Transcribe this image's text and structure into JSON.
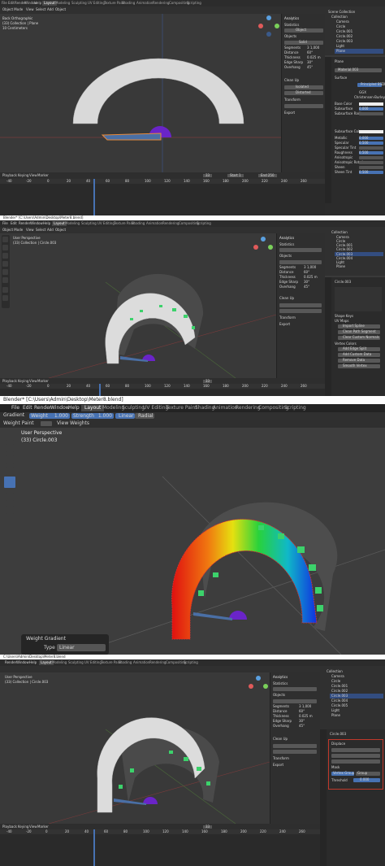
{
  "panel1": {
    "header": {
      "menus": [
        "View",
        "Select",
        "Add",
        "Object"
      ],
      "mode": "Object Mode",
      "tabs": [
        "Layout",
        "Modeling",
        "Sculpting",
        "UV Editing",
        "Texture Paint",
        "Shading",
        "Animation",
        "Rendering",
        "Compositing",
        "Scripting"
      ],
      "active_tab": "Layout"
    },
    "overlay": {
      "line1": "Back Orthographic",
      "line2": "(33) Collection | Plane",
      "line3": "10 Centimeters"
    },
    "npanel": {
      "analytics": "Analytics",
      "statistics": "Statistics",
      "mode": "Object",
      "objects": "Objects",
      "stats_title": "Solid",
      "rows": [
        {
          "label": "Segments",
          "value": "3 1,000"
        },
        {
          "label": "Distance",
          "value": "60°"
        },
        {
          "label": "Thickness",
          "value": "0.025 m"
        },
        {
          "label": "Edge Sharp",
          "value": "30°"
        },
        {
          "label": "Overhang",
          "value": "45°"
        }
      ],
      "sections": [
        "Clean Up",
        "Transform",
        "Export"
      ],
      "clean_up_buttons": [
        "Isolated",
        "Distorted"
      ],
      "transform": "Transform",
      "export": "Export"
    },
    "outliner": {
      "title": "Scene Collection",
      "items": [
        "Collection",
        "Camera",
        "Circle",
        "Circle.001",
        "Circle.002",
        "Circle.003",
        "Light",
        "Plane"
      ]
    },
    "properties": {
      "object": "Plane",
      "material": "Material.003",
      "surface": "Surface",
      "surface_value": "Principled BSDF",
      "rows": [
        "GGX",
        "Christensen-Burley",
        "Base Color",
        "Subsurface",
        "Subsurface Radius",
        "Subsurface Color",
        "Metallic",
        "Specular",
        "Specular Tint",
        "Roughness",
        "Anisotropic",
        "Anisotropic Rotation",
        "Sheen",
        "Sheen Tint"
      ],
      "values": [
        "0.000",
        "0.000",
        "0.500",
        "0.500",
        "0.000",
        "0.500",
        "0.000",
        "0.000",
        "0.500"
      ]
    },
    "timeline": {
      "menus": [
        "Playback",
        "Keying",
        "View",
        "Marker"
      ],
      "frame": "33",
      "start": "Start 1",
      "end": "End 250",
      "ticks": [
        "-40",
        "-20",
        "0",
        "20",
        "40",
        "60",
        "80",
        "100",
        "120",
        "140",
        "160",
        "180",
        "200",
        "220",
        "240",
        "260"
      ]
    }
  },
  "panel2": {
    "titlebar": "Blender* [C:\\Users\\Admin\\Desktop\\Meter8.blend]",
    "header": {
      "menus": [
        "File",
        "Edit",
        "Render",
        "Window",
        "Help"
      ],
      "tabs": [
        "Layout",
        "Modeling",
        "Sculpting",
        "UV Editing",
        "Texture Paint",
        "Shading",
        "Animation",
        "Rendering",
        "Compositing",
        "Scripting"
      ],
      "mode": "Object Mode",
      "sub_menus": [
        "View",
        "Select",
        "Add",
        "Object"
      ]
    },
    "overlay": {
      "line1": "User Perspective",
      "line2": "(33) Collection | Circle.003"
    },
    "npanel": {
      "analytics": "Analytics",
      "statistics": "Statistics",
      "objects": "Objects",
      "rows": [
        {
          "label": "Segments",
          "value": "3 1,000"
        },
        {
          "label": "Distance",
          "value": "60°"
        },
        {
          "label": "Thickness",
          "value": "0.025 m"
        },
        {
          "label": "Edge Sharp",
          "value": "30°"
        },
        {
          "label": "Overhang",
          "value": "45°"
        }
      ],
      "sections": [
        "Clean Up",
        "Transform",
        "Export"
      ]
    },
    "outliner": {
      "items": [
        "Collection",
        "Camera",
        "Circle",
        "Circle.001",
        "Circle.002",
        "Circle.003",
        "Circle.004",
        "Light",
        "Plane"
      ]
    },
    "properties": {
      "object": "Circle.003",
      "sections": [
        "Vertex Groups",
        "Shape Keys",
        "UV Maps",
        "Vertex Colors",
        "Face Maps",
        "Normals",
        "Texture Space",
        "Remesh",
        "Geometry Data",
        "Custom Properties"
      ],
      "buttons": [
        "Import Spline",
        "Clean Path Segment",
        "Clear Custom Normals",
        "Add Edge Split",
        "Add Custom Data",
        "Remove Data",
        "Smooth Vertex"
      ]
    },
    "timeline": {
      "menus": [
        "Playback",
        "Keying",
        "View",
        "Marker"
      ],
      "frame": "33",
      "ticks": [
        "-40",
        "-20",
        "0",
        "20",
        "40",
        "60",
        "80",
        "100",
        "120",
        "140",
        "160",
        "180",
        "200",
        "220",
        "240",
        "260"
      ]
    }
  },
  "panel3": {
    "titlebar": "Blender* [C:\\Users\\Admin\\Desktop\\Meter8.blend]",
    "menus": [
      "File",
      "Edit",
      "Render",
      "Window",
      "Help"
    ],
    "tabs": [
      "Layout",
      "Modeling",
      "Sculpting",
      "UV Editing",
      "Texture Paint",
      "Shading",
      "Animation",
      "Rendering",
      "Compositing",
      "Scripting"
    ],
    "active_tab": "Layout",
    "tool_header": {
      "tool": "Gradient",
      "weight_label": "Weight",
      "weight_value": "1.000",
      "strength_label": "Strength",
      "strength_value": "1.000",
      "linear": "Linear",
      "radial": "Radial"
    },
    "mode_header": {
      "mode": "Weight Paint",
      "view": "View",
      "weights": "Weights"
    },
    "overlay": {
      "line1": "User Perspective",
      "line2": "(33) Circle.003"
    },
    "redo": {
      "title": "Weight Gradient",
      "type_label": "Type",
      "type_value": "Linear"
    }
  },
  "panel4": {
    "titlebar": "C:\\Users\\Admin\\Desktop\\Meter8.blend",
    "header": {
      "menus": [
        "Render",
        "Window",
        "Help"
      ],
      "tabs": [
        "Layout",
        "Modeling",
        "Sculpting",
        "UV Editing",
        "Texture Paint",
        "Shading",
        "Animation",
        "Rendering",
        "Compositing",
        "Scripting"
      ]
    },
    "overlay": {
      "line1": "User Perspective",
      "line2": "(33) Collection | Circle.003"
    },
    "npanel": {
      "analytics": "Analytics",
      "statistics": "Statistics",
      "objects": "Objects",
      "rows": [
        {
          "label": "Segments",
          "value": "3 1,000"
        },
        {
          "label": "Distance",
          "value": "60°"
        },
        {
          "label": "Thickness",
          "value": "0.025 m"
        },
        {
          "label": "Edge Sharp",
          "value": "30°"
        },
        {
          "label": "Overhang",
          "value": "45°"
        }
      ],
      "sections": [
        "Clean Up",
        "Transform",
        "Export"
      ]
    },
    "outliner": {
      "items": [
        "Collection",
        "Camera",
        "Circle",
        "Circle.001",
        "Circle.002",
        "Circle.003",
        "Circle.004",
        "Circle.005",
        "Light",
        "Plane"
      ]
    },
    "properties": {
      "object": "Circle.003",
      "modifier": "Displace",
      "modifier2": "Mask",
      "vertex_group": "Group",
      "mode": "Vertex Group",
      "threshold_label": "Threshold",
      "threshold": "0.000"
    },
    "timeline": {
      "menus": [
        "Playback",
        "Keying",
        "View",
        "Marker"
      ],
      "frame": "33",
      "ticks": [
        "-40",
        "-20",
        "0",
        "20",
        "40",
        "60",
        "80",
        "100",
        "120",
        "140",
        "160",
        "180",
        "200",
        "220",
        "240",
        "260"
      ]
    }
  },
  "colors": {
    "accent": "#4772b3",
    "object_white": "#d9d9d9",
    "object_dark": "#4d4d4d",
    "marker_green": "#3cd26b",
    "purple": "#6a24c8",
    "selection_red": "#c0392b"
  }
}
